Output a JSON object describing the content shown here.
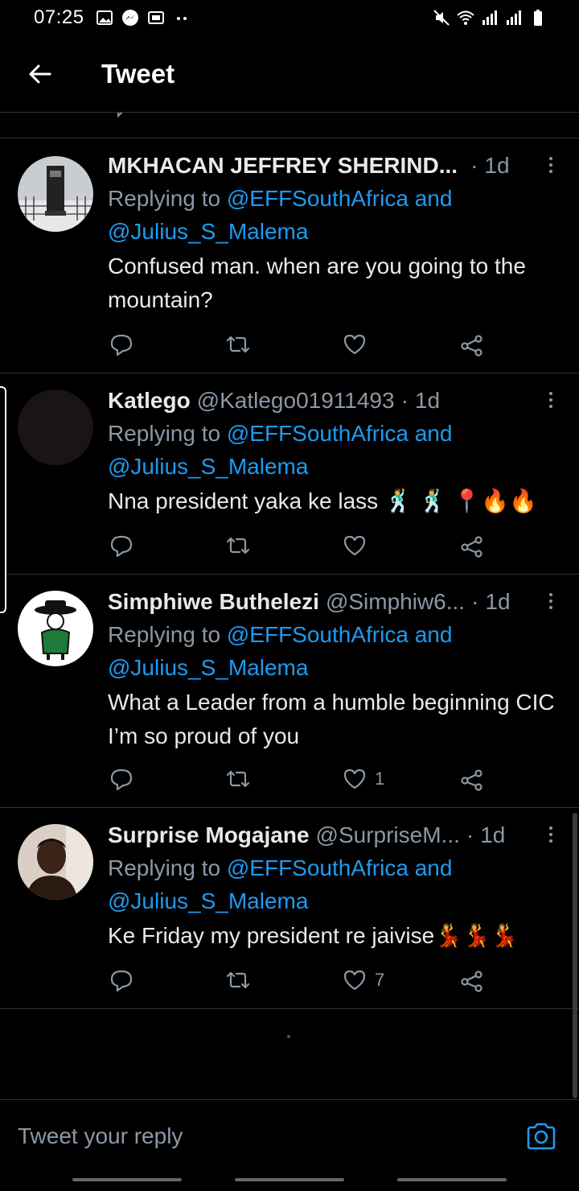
{
  "status_bar": {
    "time": "07:25"
  },
  "header": {
    "title": "Tweet",
    "back_icon": "arrow-left-icon"
  },
  "colors": {
    "accent": "#1d9bf0",
    "muted": "#8b98a5",
    "background": "#000000",
    "divider": "#2f3336"
  },
  "tweets": [
    {
      "name": "MKHACAN JEFFREY SHERIND...",
      "handle": "",
      "dot": "·",
      "time": "1d",
      "replying_prefix": "Replying to",
      "mention1": "@EFFSouthAfrica",
      "and": "and",
      "mention2": "@Julius_S_Malema",
      "text": "Confused man. when are you going to the mountain?",
      "likes": ""
    },
    {
      "name": "Katlego",
      "handle": "@Katlego01911493",
      "dot": "·",
      "time": "1d",
      "replying_prefix": "Replying to",
      "mention1": "@EFFSouthAfrica",
      "and": "and",
      "mention2": "@Julius_S_Malema",
      "text": "Nna president yaka ke lass 🕺 🕺 📍🔥🔥",
      "likes": ""
    },
    {
      "name": "Simphiwe Buthelezi",
      "handle": "@Simphiw6...",
      "dot": "·",
      "time": "1d",
      "replying_prefix": "Replying to",
      "mention1": "@EFFSouthAfrica",
      "and": "and",
      "mention2": "@Julius_S_Malema",
      "text": "What a Leader from a humble beginning CIC I’m so proud of you",
      "likes": "1"
    },
    {
      "name": "Surprise Mogajane",
      "handle": "@SurpriseM...",
      "dot": "·",
      "time": "1d",
      "replying_prefix": "Replying to",
      "mention1": "@EFFSouthAfrica",
      "and": "and",
      "mention2": "@Julius_S_Malema",
      "text": "Ke Friday my president re jaivise💃💃💃",
      "likes": "7"
    }
  ],
  "reply_bar": {
    "placeholder": "Tweet your reply",
    "camera_icon": "camera-icon"
  }
}
